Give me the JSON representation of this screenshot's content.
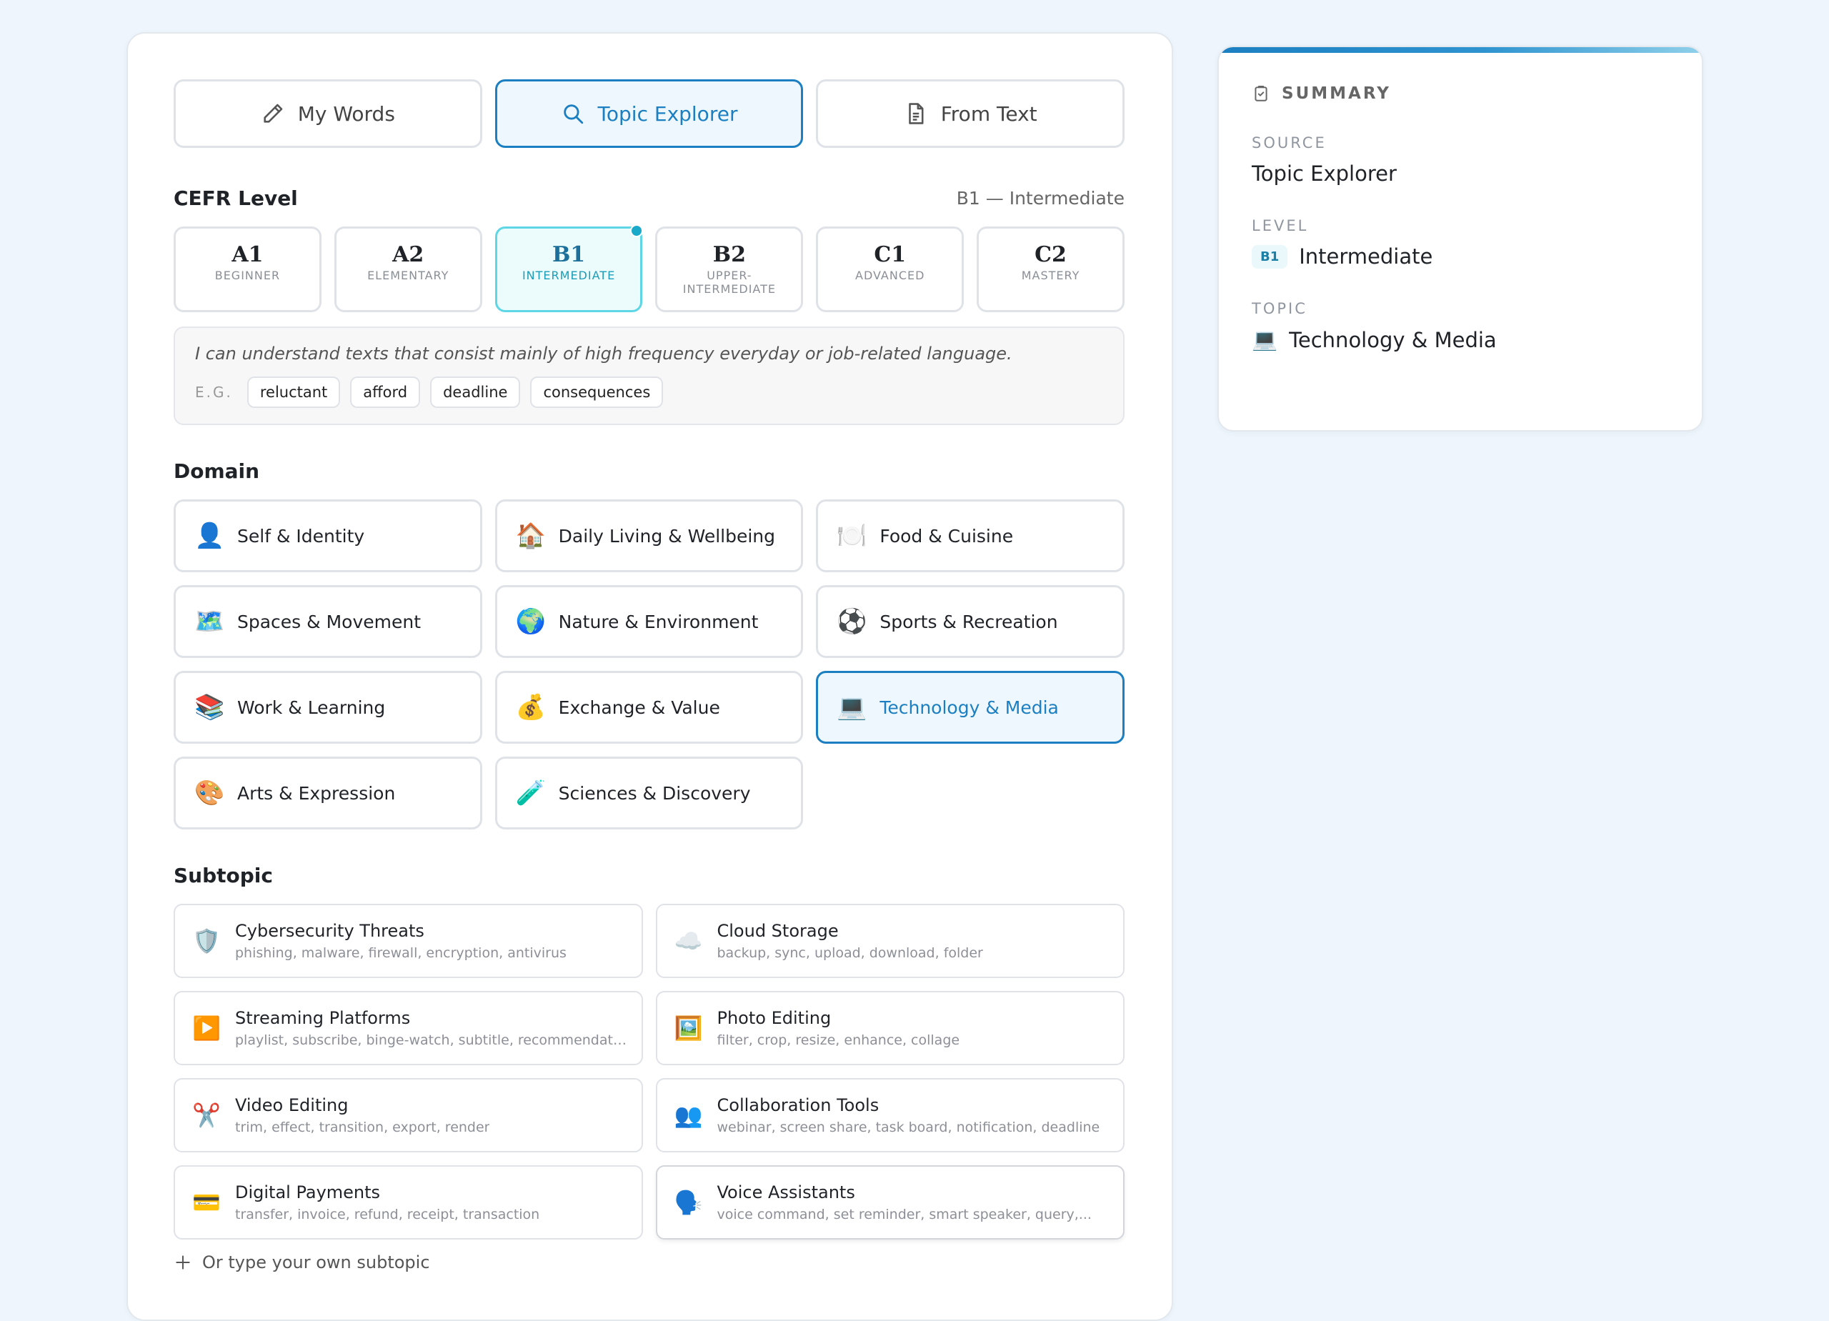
{
  "mode_tabs": [
    {
      "label": "My Words",
      "icon": "pencil-icon",
      "active": false
    },
    {
      "label": "Topic Explorer",
      "icon": "search-icon",
      "active": true
    },
    {
      "label": "From Text",
      "icon": "document-icon",
      "active": false
    }
  ],
  "cefr": {
    "title": "CEFR Level",
    "selected_label": "B1 — Intermediate",
    "levels": [
      {
        "code": "A1",
        "name": "Beginner"
      },
      {
        "code": "A2",
        "name": "Elementary"
      },
      {
        "code": "B1",
        "name": "Intermediate"
      },
      {
        "code": "B2",
        "name": "Upper-Intermediate"
      },
      {
        "code": "C1",
        "name": "Advanced"
      },
      {
        "code": "C2",
        "name": "Mastery"
      }
    ],
    "description": "I can understand texts that consist mainly of high frequency everyday or job-related language.",
    "eg_label": "E.G.",
    "examples": [
      "reluctant",
      "afford",
      "deadline",
      "consequences"
    ]
  },
  "domain": {
    "title": "Domain",
    "items": [
      {
        "emoji": "👤",
        "label": "Self & Identity"
      },
      {
        "emoji": "🏠",
        "label": "Daily Living & Wellbeing"
      },
      {
        "emoji": "🍽️",
        "label": "Food & Cuisine"
      },
      {
        "emoji": "🗺️",
        "label": "Spaces & Movement"
      },
      {
        "emoji": "🌍",
        "label": "Nature & Environment"
      },
      {
        "emoji": "⚽",
        "label": "Sports & Recreation"
      },
      {
        "emoji": "📚",
        "label": "Work & Learning"
      },
      {
        "emoji": "💰",
        "label": "Exchange & Value"
      },
      {
        "emoji": "💻",
        "label": "Technology & Media"
      },
      {
        "emoji": "🎨",
        "label": "Arts & Expression"
      },
      {
        "emoji": "🧪",
        "label": "Sciences & Discovery"
      }
    ]
  },
  "subtopic": {
    "title": "Subtopic",
    "items": [
      {
        "emoji": "🛡️",
        "title": "Cybersecurity Threats",
        "keywords": "phishing, malware, firewall, encryption, antivirus"
      },
      {
        "emoji": "☁️",
        "title": "Cloud Storage",
        "keywords": "backup, sync, upload, download, folder"
      },
      {
        "emoji": "▶️",
        "title": "Streaming Platforms",
        "keywords": "playlist, subscribe, binge-watch, subtitle, recommendation"
      },
      {
        "emoji": "🖼️",
        "title": "Photo Editing",
        "keywords": "filter, crop, resize, enhance, collage"
      },
      {
        "emoji": "✂️",
        "title": "Video Editing",
        "keywords": "trim, effect, transition, export, render"
      },
      {
        "emoji": "👥",
        "title": "Collaboration Tools",
        "keywords": "webinar, screen share, task board, notification, deadline"
      },
      {
        "emoji": "💳",
        "title": "Digital Payments",
        "keywords": "transfer, invoice, refund, receipt, transaction"
      },
      {
        "emoji": "🗣️",
        "title": "Voice Assistants",
        "keywords": "voice command, set reminder, smart speaker, query,..."
      }
    ],
    "custom_label": "Or type your own subtopic"
  },
  "summary": {
    "title": "SUMMARY",
    "source_label": "SOURCE",
    "source_value": "Topic Explorer",
    "level_label": "LEVEL",
    "level_code": "B1",
    "level_value": "Intermediate",
    "topic_label": "TOPIC",
    "topic_emoji": "💻",
    "topic_value": "Technology & Media"
  }
}
